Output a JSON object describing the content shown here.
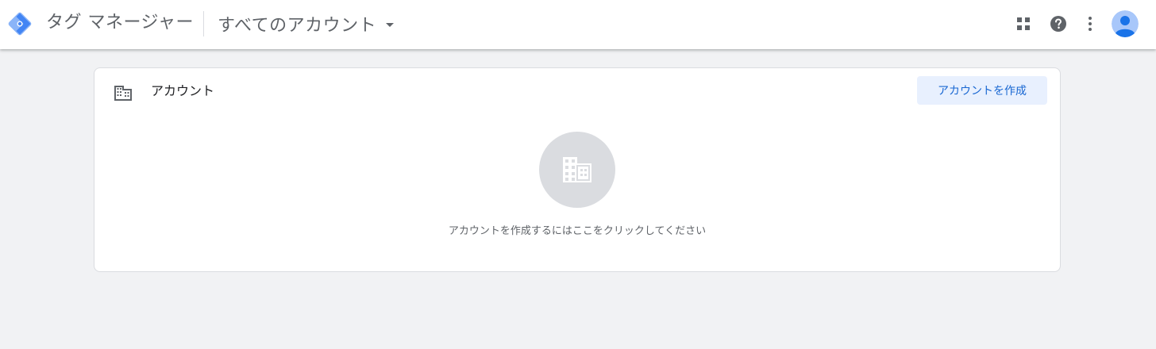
{
  "header": {
    "product_name": "タグ マネージャー",
    "account_selector": {
      "label": "すべてのアカウント",
      "icon": "arrow-drop-down-icon"
    },
    "actions": [
      {
        "icon": "apps-grid-icon"
      },
      {
        "icon": "help-icon"
      },
      {
        "icon": "more-vert-icon"
      },
      {
        "icon": "account-avatar-icon"
      }
    ]
  },
  "accounts_card": {
    "title": "アカウント",
    "title_icon": "building-icon",
    "create_button_label": "アカウントを作成",
    "empty_state": {
      "icon": "building-icon",
      "message": "アカウントを作成するにはここをクリックしてください"
    }
  },
  "colors": {
    "background": "#f1f2f4",
    "accent": "#1967d2",
    "accent_light": "#e8f0fe",
    "logo_blue": "#4285f4",
    "logo_light_blue": "#8ab4f8"
  }
}
